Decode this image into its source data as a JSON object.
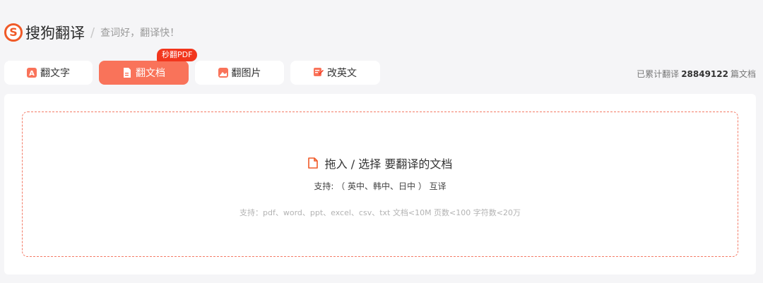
{
  "header": {
    "logo_mark": "S",
    "app_name": "搜狗翻译",
    "separator": "/",
    "slogan": "查词好，翻译快！"
  },
  "tabs": [
    {
      "label": "翻文字",
      "icon": "text-translate-icon",
      "active": false
    },
    {
      "label": "翻文档",
      "icon": "document-icon",
      "active": true
    },
    {
      "label": "翻图片",
      "icon": "image-icon",
      "active": false
    },
    {
      "label": "改英文",
      "icon": "edit-english-icon",
      "active": false
    }
  ],
  "badge": "秒翻PDF",
  "counter": {
    "prefix": "已累计翻译",
    "count": "28849122",
    "suffix": "篇文档"
  },
  "dropzone": {
    "title": "拖入 / 选择 要翻译的文档",
    "supported_langs": "支持: （ 英中、韩中、日中 ） 互译",
    "supported_formats": "支持：pdf、word、ppt、excel、csv、txt    文档<10M 页数<100 字符数<20万"
  },
  "colors": {
    "accent": "#f9735a",
    "brand": "#f05a28",
    "badge": "#f2361d",
    "dashed_border": "#f37a66"
  }
}
